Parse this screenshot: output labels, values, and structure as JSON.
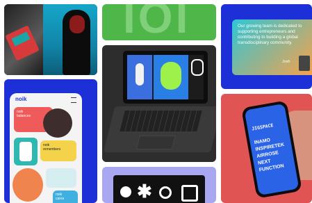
{
  "colors": {
    "blue": "#1d2fd6",
    "green": "#4fb64a",
    "teal": "#1fb7a8",
    "coral": "#e05454",
    "lavender": "#a9a6f2",
    "dark": "#2b2b2b"
  },
  "tile_top_left": {
    "icon": "photo-collage-icon"
  },
  "tile_top_center": {
    "big_text": "IOI"
  },
  "tile_laptop": {
    "icon": "laptop-mockup-icon"
  },
  "tile_top_right": {
    "quote": "Our growing team is dedicated to supporting entrepreneurs and contributing to building a global transdisciplinary community.",
    "author": "Josh"
  },
  "tile_bottom_left": {
    "logo": "noik",
    "card1": "noik\nbalances",
    "card2": "noik\nremembers",
    "card3": "noik\ncares"
  },
  "tile_bottom_center": {
    "shapes": [
      "circle",
      "asterisk",
      "ring",
      "square"
    ]
  },
  "tile_bottom_right": {
    "app_title": "JIGSPACE",
    "list": [
      "INAMO",
      "INSPIRETEK",
      "AIRROSE",
      "NEXT",
      "FUNCTION"
    ]
  }
}
